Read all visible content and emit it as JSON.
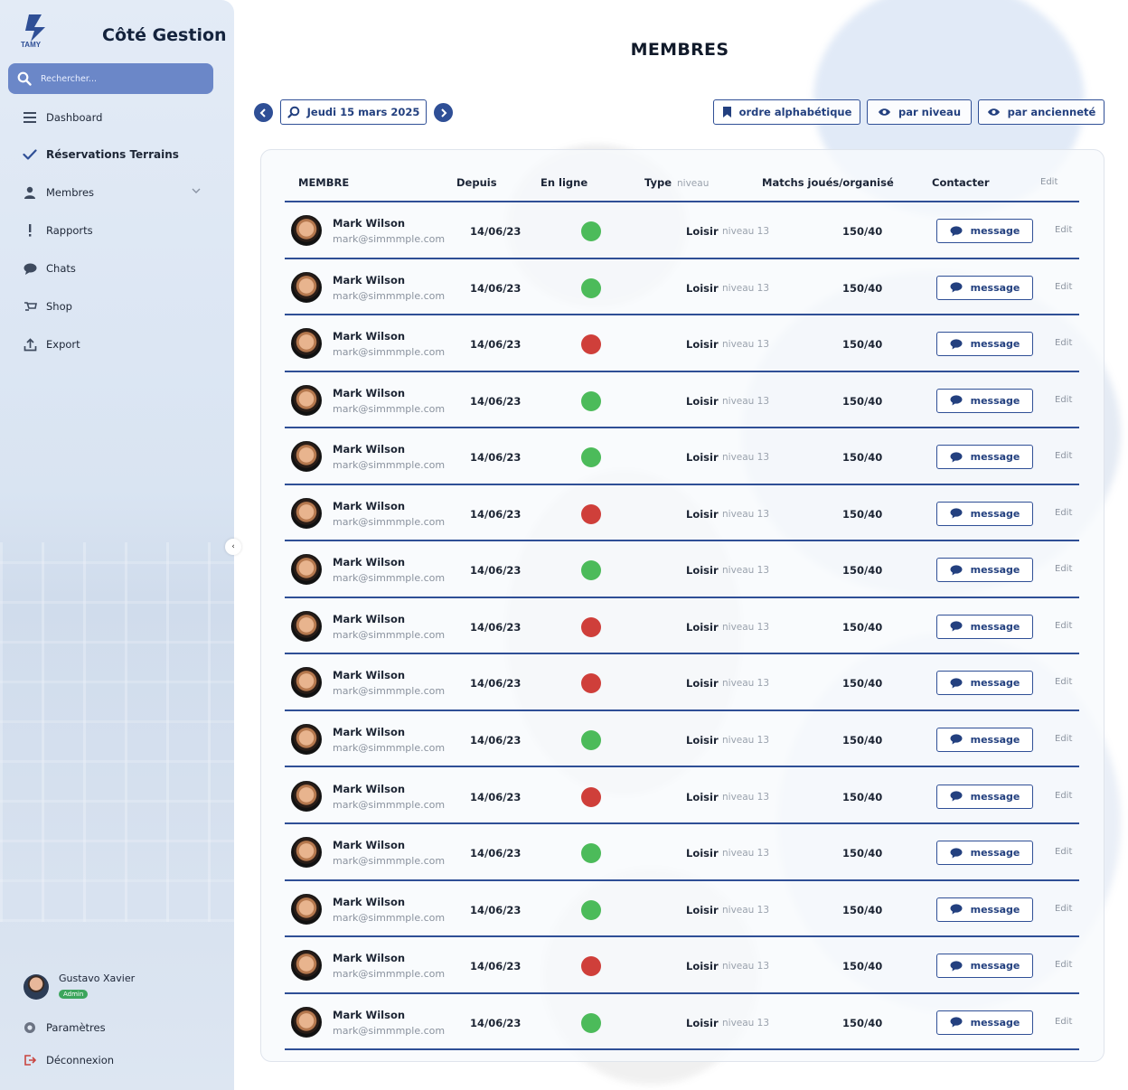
{
  "app": {
    "brand_title": "Côté Gestion",
    "logo_text": "TAMY",
    "page_title": "MEMBRES"
  },
  "sidebar": {
    "search_placeholder": "Rechercher...",
    "items": [
      {
        "label": "Dashboard",
        "icon": "menu-icon"
      },
      {
        "label": "Réservations Terrains",
        "icon": "check-icon",
        "active": true
      },
      {
        "label": "Membres",
        "icon": "user-icon",
        "has_chevron": true
      },
      {
        "label": "Rapports",
        "icon": "exclamation-icon"
      },
      {
        "label": "Chats",
        "icon": "chat-bubble-icon"
      },
      {
        "label": "Shop",
        "icon": "cart-icon"
      },
      {
        "label": "Export",
        "icon": "upload-icon"
      }
    ],
    "user": {
      "name": "Gustavo Xavier",
      "role": "Admin"
    },
    "settings_label": "Paramètres",
    "logout_label": "Déconnexion"
  },
  "toolbar": {
    "date_label": "Jeudi 15 mars 2025",
    "sort_alpha": "ordre alphabétique",
    "sort_level": "par niveau",
    "sort_seniority": "par ancienneté"
  },
  "table": {
    "headers": {
      "member": "MEMBRE",
      "since": "Depuis",
      "online": "En ligne",
      "type": "Type",
      "type_sub": "niveau",
      "matches": "Matchs joués/organisé",
      "contact": "Contacter",
      "edit": "Edit"
    },
    "colors": {
      "online": "#4cbb5a",
      "offline": "#cf3f3a",
      "accent": "#2f4f96"
    },
    "rows": [
      {
        "name": "Mark Wilson",
        "email": "mark@simmmple.com",
        "since": "14/06/23",
        "online": true,
        "type": "Loisir",
        "level": "niveau 13",
        "matches": "150/40",
        "action": "message",
        "edit": "Edit"
      },
      {
        "name": "Mark Wilson",
        "email": "mark@simmmple.com",
        "since": "14/06/23",
        "online": true,
        "type": "Loisir",
        "level": "niveau 13",
        "matches": "150/40",
        "action": "message",
        "edit": "Edit"
      },
      {
        "name": "Mark Wilson",
        "email": "mark@simmmple.com",
        "since": "14/06/23",
        "online": false,
        "type": "Loisir",
        "level": "niveau 13",
        "matches": "150/40",
        "action": "message",
        "edit": "Edit"
      },
      {
        "name": "Mark Wilson",
        "email": "mark@simmmple.com",
        "since": "14/06/23",
        "online": true,
        "type": "Loisir",
        "level": "niveau 13",
        "matches": "150/40",
        "action": "message",
        "edit": "Edit"
      },
      {
        "name": "Mark Wilson",
        "email": "mark@simmmple.com",
        "since": "14/06/23",
        "online": true,
        "type": "Loisir",
        "level": "niveau 13",
        "matches": "150/40",
        "action": "message",
        "edit": "Edit"
      },
      {
        "name": "Mark Wilson",
        "email": "mark@simmmple.com",
        "since": "14/06/23",
        "online": false,
        "type": "Loisir",
        "level": "niveau 13",
        "matches": "150/40",
        "action": "message",
        "edit": "Edit"
      },
      {
        "name": "Mark Wilson",
        "email": "mark@simmmple.com",
        "since": "14/06/23",
        "online": true,
        "type": "Loisir",
        "level": "niveau 13",
        "matches": "150/40",
        "action": "message",
        "edit": "Edit"
      },
      {
        "name": "Mark Wilson",
        "email": "mark@simmmple.com",
        "since": "14/06/23",
        "online": false,
        "type": "Loisir",
        "level": "niveau 13",
        "matches": "150/40",
        "action": "message",
        "edit": "Edit"
      },
      {
        "name": "Mark Wilson",
        "email": "mark@simmmple.com",
        "since": "14/06/23",
        "online": false,
        "type": "Loisir",
        "level": "niveau 13",
        "matches": "150/40",
        "action": "message",
        "edit": "Edit"
      },
      {
        "name": "Mark Wilson",
        "email": "mark@simmmple.com",
        "since": "14/06/23",
        "online": true,
        "type": "Loisir",
        "level": "niveau 13",
        "matches": "150/40",
        "action": "message",
        "edit": "Edit"
      },
      {
        "name": "Mark Wilson",
        "email": "mark@simmmple.com",
        "since": "14/06/23",
        "online": false,
        "type": "Loisir",
        "level": "niveau 13",
        "matches": "150/40",
        "action": "message",
        "edit": "Edit"
      },
      {
        "name": "Mark Wilson",
        "email": "mark@simmmple.com",
        "since": "14/06/23",
        "online": true,
        "type": "Loisir",
        "level": "niveau 13",
        "matches": "150/40",
        "action": "message",
        "edit": "Edit"
      },
      {
        "name": "Mark Wilson",
        "email": "mark@simmmple.com",
        "since": "14/06/23",
        "online": true,
        "type": "Loisir",
        "level": "niveau 13",
        "matches": "150/40",
        "action": "message",
        "edit": "Edit"
      },
      {
        "name": "Mark Wilson",
        "email": "mark@simmmple.com",
        "since": "14/06/23",
        "online": false,
        "type": "Loisir",
        "level": "niveau 13",
        "matches": "150/40",
        "action": "message",
        "edit": "Edit"
      },
      {
        "name": "Mark Wilson",
        "email": "mark@simmmple.com",
        "since": "14/06/23",
        "online": true,
        "type": "Loisir",
        "level": "niveau 13",
        "matches": "150/40",
        "action": "message",
        "edit": "Edit"
      }
    ]
  }
}
